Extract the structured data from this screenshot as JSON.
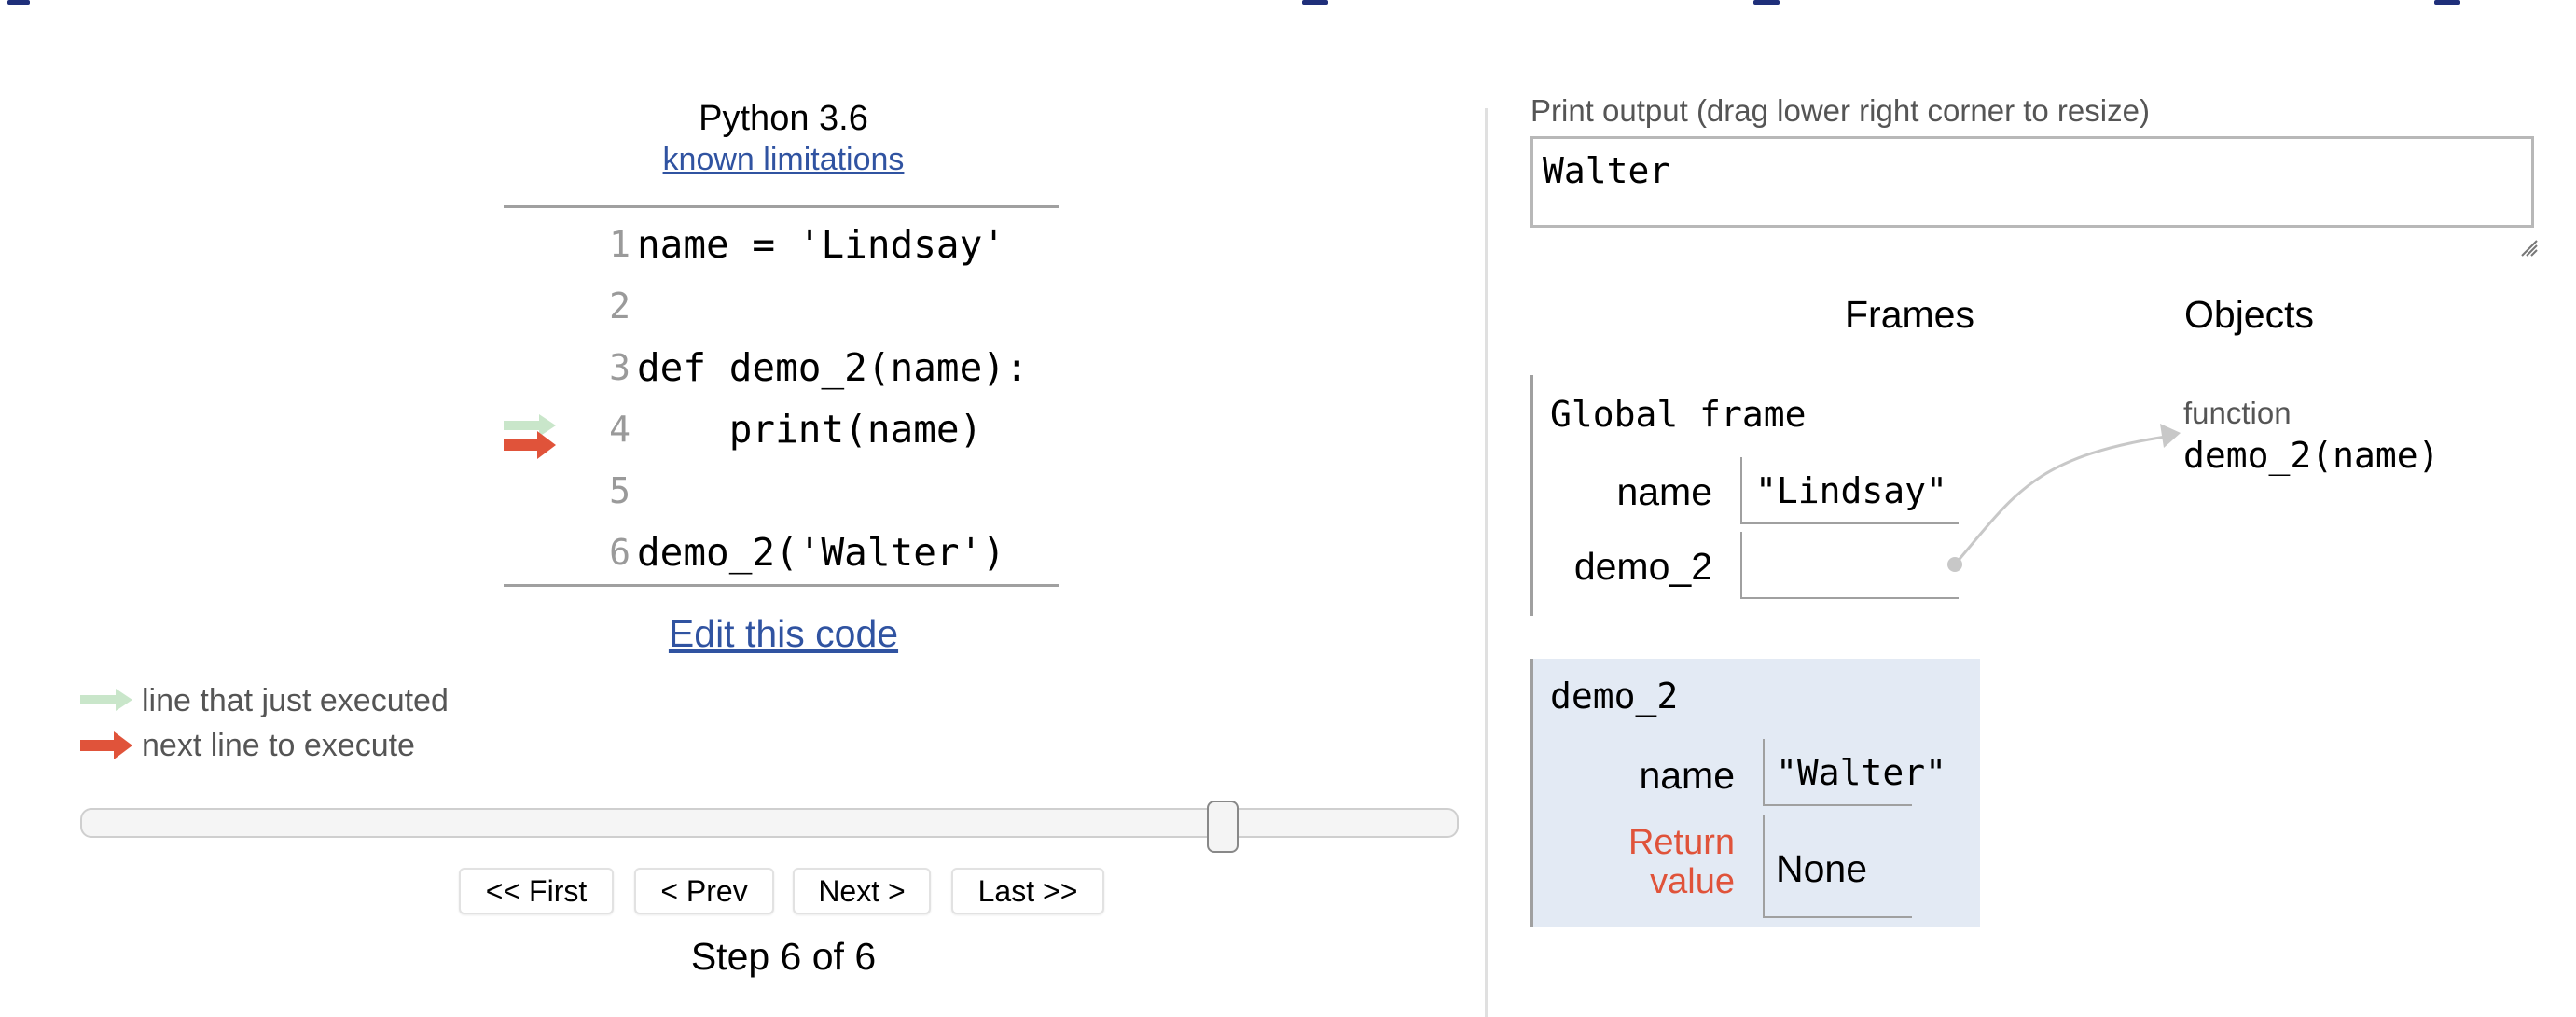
{
  "header": {
    "language": "Python 3.6",
    "limitations_link": "known limitations"
  },
  "code": {
    "lines": [
      {
        "num": "1",
        "text": "name = 'Lindsay'"
      },
      {
        "num": "2",
        "text": ""
      },
      {
        "num": "3",
        "text": "def demo_2(name):"
      },
      {
        "num": "4",
        "text": "    print(name)"
      },
      {
        "num": "5",
        "text": ""
      },
      {
        "num": "6",
        "text": "demo_2('Walter')"
      }
    ],
    "just_executed_line": 4,
    "next_line": 4
  },
  "edit_link": "Edit this code",
  "legend": {
    "just_executed": "line that just executed",
    "next_line": "next line to execute"
  },
  "controls": {
    "first": "<< First",
    "prev": "< Prev",
    "next": "Next >",
    "last": "Last >>",
    "step_text": "Step 6 of 6",
    "slider_position": 0.83
  },
  "output": {
    "label": "Print output (drag lower right corner to resize)",
    "text": "Walter"
  },
  "visualization": {
    "frames_header": "Frames",
    "objects_header": "Objects",
    "global_frame": {
      "title": "Global frame",
      "vars": [
        {
          "name": "name",
          "value": "\"Lindsay\""
        },
        {
          "name": "demo_2",
          "value": ""
        }
      ]
    },
    "call_frame": {
      "title": "demo_2",
      "vars": [
        {
          "name": "name",
          "value": "\"Walter\""
        },
        {
          "name": "Return\nvalue",
          "value": "None"
        }
      ]
    },
    "object": {
      "type": "function",
      "value": "demo_2(name)"
    }
  },
  "colors": {
    "link": "#3053a1",
    "arrow_just_executed": "#c9e6ca",
    "arrow_next": "#e0533a",
    "return_label": "#e0533a",
    "frame_highlight": "#e3eaf4",
    "pointer": "#c8c8c8"
  }
}
